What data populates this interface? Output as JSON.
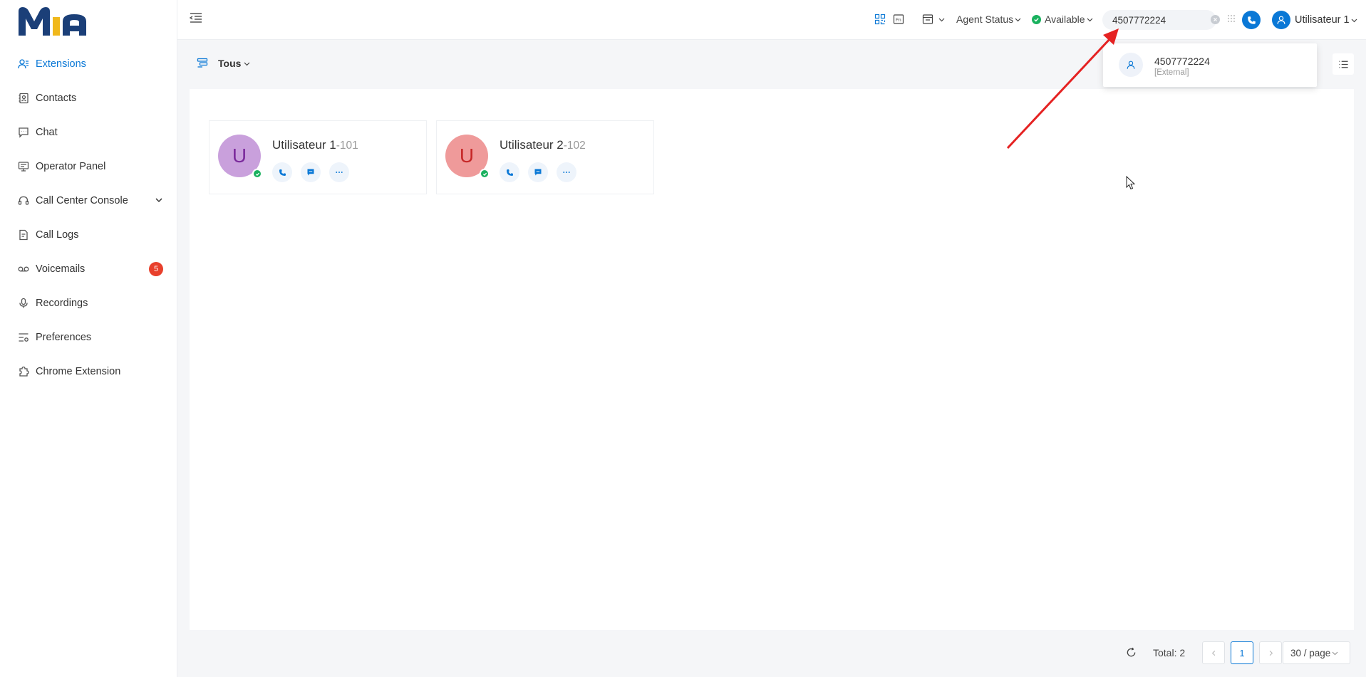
{
  "app": {
    "logo_text": "MIA"
  },
  "sidebar": {
    "items": [
      {
        "label": "Extensions",
        "icon": "extensions-icon",
        "active": true
      },
      {
        "label": "Contacts",
        "icon": "contacts-icon"
      },
      {
        "label": "Chat",
        "icon": "chat-icon"
      },
      {
        "label": "Operator Panel",
        "icon": "operator-panel-icon"
      },
      {
        "label": "Call Center Console",
        "icon": "headset-icon",
        "expandable": true
      },
      {
        "label": "Call Logs",
        "icon": "call-logs-icon"
      },
      {
        "label": "Voicemails",
        "icon": "voicemail-icon",
        "badge": "5"
      },
      {
        "label": "Recordings",
        "icon": "microphone-icon"
      },
      {
        "label": "Preferences",
        "icon": "preferences-icon"
      },
      {
        "label": "Chrome Extension",
        "icon": "puzzle-icon"
      }
    ]
  },
  "header": {
    "agent_status_label": "Agent Status",
    "availability_label": "Available",
    "search_value": "4507772224",
    "user_name": "Utilisateur 1"
  },
  "toolbar": {
    "filter_label": "Tous"
  },
  "cards": [
    {
      "name": "Utilisateur 1",
      "ext": "-101",
      "initial": "U",
      "avatar_bg": "#c9a0dc",
      "initial_color": "#7b2a9c"
    },
    {
      "name": "Utilisateur 2",
      "ext": "-102",
      "initial": "U",
      "avatar_bg": "#ef9a9a",
      "initial_color": "#c62828"
    }
  ],
  "search_result": {
    "number": "4507772224",
    "type": "[External]"
  },
  "pagination": {
    "total": "Total: 2",
    "current_page": "1",
    "page_size": "30 / page"
  },
  "colors": {
    "accent": "#0a78d6",
    "online": "#19b15e",
    "badge": "#e8402c",
    "annotation": "#e52222"
  }
}
